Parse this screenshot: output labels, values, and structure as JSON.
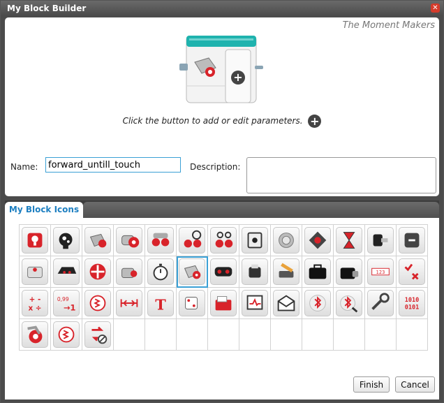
{
  "window": {
    "title": "My Block Builder",
    "close_glyph": "✕"
  },
  "top_panel": {
    "brand": "The Moment Makers",
    "hint": "Click the button to add or edit parameters.",
    "hint_button_glyph": "+",
    "name_label": "Name:",
    "name_value": "forward_untill_touch",
    "description_label": "Description:",
    "description_value": ""
  },
  "tabs": [
    {
      "label": "My Block Icons",
      "active": true
    }
  ],
  "icons": [
    "brain-icon",
    "brain-gears-icon",
    "medium-motor-icon",
    "large-motor-icon",
    "move-steering-icon",
    "move-steering-wheel-icon",
    "move-tank-icon",
    "display-icon",
    "sound-icon",
    "brick-status-light-icon",
    "wait-hourglass-icon",
    "loop-icon",
    "switch-icon",
    "brick-buttons-icon",
    "infrared-sensor-icon",
    "direction-pad-icon",
    "medium-motor-rotation-icon",
    "timer-stopwatch-icon",
    "my-block-icon",
    "ultrasonic-sensor-icon",
    "gyro-sensor-icon",
    "temperature-sensor-icon",
    "data-case-icon",
    "data-case-lock-icon",
    "array-icon",
    "logic-operations-icon",
    "math-icon",
    "round-icon",
    "compare-icon",
    "range-icon",
    "text-icon",
    "random-dice-icon",
    "file-access-icon",
    "data-logging-icon",
    "messaging-icon",
    "bluetooth-icon",
    "bluetooth-settings-icon",
    "keep-awake-icon",
    "raw-sensor-value-icon",
    "unregulated-motor-icon",
    "invert-motor-icon",
    "stop-icon"
  ],
  "selected_icon_index": 18,
  "empty_cells": 10,
  "buttons": {
    "finish": "Finish",
    "cancel": "Cancel"
  },
  "colors": {
    "accent_blue": "#1d7fc1",
    "block_teal": "#1fb3ae",
    "icon_red": "#d8232a",
    "title_bar": "#4b4b4b",
    "close_red": "#d43b2b"
  }
}
